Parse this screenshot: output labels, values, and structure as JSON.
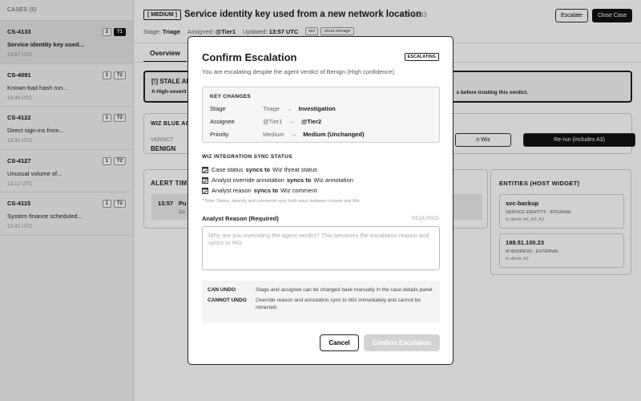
{
  "sidebar": {
    "header": "CASES (5)",
    "cases": [
      {
        "id": "CS-4133",
        "title": "Service identity key used...",
        "time": "13:57 UTC",
        "count": "3",
        "tier": "T1"
      },
      {
        "id": "CS-4091",
        "title": "Known-bad hash run...",
        "time": "13:40 UTC",
        "count": "1",
        "tier": "T2"
      },
      {
        "id": "CS-4122",
        "title": "Direct sign-ins from...",
        "time": "13:32 UTC",
        "count": "1",
        "tier": "T2"
      },
      {
        "id": "CS-4127",
        "title": "Unusual volume of...",
        "time": "13:12 UTC",
        "count": "1",
        "tier": "T2"
      },
      {
        "id": "CS-4115",
        "title": "System finance scheduled...",
        "time": "12:42 UTC",
        "count": "1",
        "tier": "T2"
      }
    ]
  },
  "header": {
    "severity": "[ MEDIUM ]",
    "title": "Service identity key used from a new network location",
    "case_id": "CS-4133",
    "stage_label": "Stage:",
    "stage_value": "Triage",
    "assigned_label": "Assigned:",
    "assigned_value": "@Tier1",
    "updated_label": "Updated:",
    "updated_value": "13:57 UTC",
    "tags": [
      "wiz",
      "cloud-storage"
    ],
    "escalate_label": "Escalate",
    "close_label": "Close Case"
  },
  "tabs": [
    "Overview"
  ],
  "banner": {
    "title": "[!] STALE AN",
    "body": "A High-severit",
    "body_right": "s before trusting this verdict."
  },
  "verdict": {
    "heading": "WIZ BLUE AG",
    "label": "VERDICT",
    "value": "BENIGN",
    "btn_wiz": "n Wiz",
    "btn_rerun": "Re-run (includes A3)"
  },
  "alerts": {
    "heading": "ALERT TIME",
    "time": "13:57",
    "text": "Pu",
    "sub": "Co"
  },
  "entities": {
    "heading": "ENTITIES (HOST WIDGET)",
    "items": [
      {
        "name": "svc-backup",
        "kind": "SERVICE IDENTITY · INTERNAL",
        "seen": "In alerts: A1, A2, A3"
      },
      {
        "name": "198.51.100.23",
        "kind": "IP ADDRESS · EXTERNAL",
        "seen": "In alerts: A1"
      }
    ]
  },
  "modal": {
    "title": "Confirm Escalation",
    "badge": "ESCALATING",
    "subtitle": "You are escalating despite the agent verdict of Benign (High confidence).",
    "key_changes": {
      "heading": "KEY CHANGES",
      "rows": [
        {
          "label": "Stage",
          "from": "Triage",
          "to": "Investigation"
        },
        {
          "label": "Assignee",
          "from": "@Tier1",
          "to": "@Tier2"
        },
        {
          "label": "Priority",
          "from": "Medium",
          "to": "Medium (Unchanged)"
        }
      ]
    },
    "sync": {
      "heading": "WIZ INTEGRATION SYNC STATUS",
      "rows": [
        {
          "pre": "Case status",
          "bold": "syncs to",
          "post": "Wiz threat status"
        },
        {
          "pre": "Analyst override annotation",
          "bold": "syncs to",
          "post": "Wiz annotation"
        },
        {
          "pre": "Analyst reason",
          "bold": "syncs to",
          "post": "Wiz comment"
        }
      ],
      "note": "* Note: Status, severity and comments sync both ways between console and Wiz."
    },
    "reason": {
      "label": "Analyst Reason (Required)",
      "required": "REQUIRED",
      "placeholder": "Why are you overriding the agent verdict? This becomes the escalation reason and syncs to Wiz.",
      "value": ""
    },
    "undo": {
      "can_label": "CAN UNDO",
      "can_text": "Stage and assignee can be changed back manually in the case details panel.",
      "cannot_label": "CANNOT UNDO",
      "cannot_text": "Override reason and annotation sync to Wiz immediately and cannot be retracted."
    },
    "cancel_label": "Cancel",
    "confirm_label": "Confirm Escalation"
  }
}
